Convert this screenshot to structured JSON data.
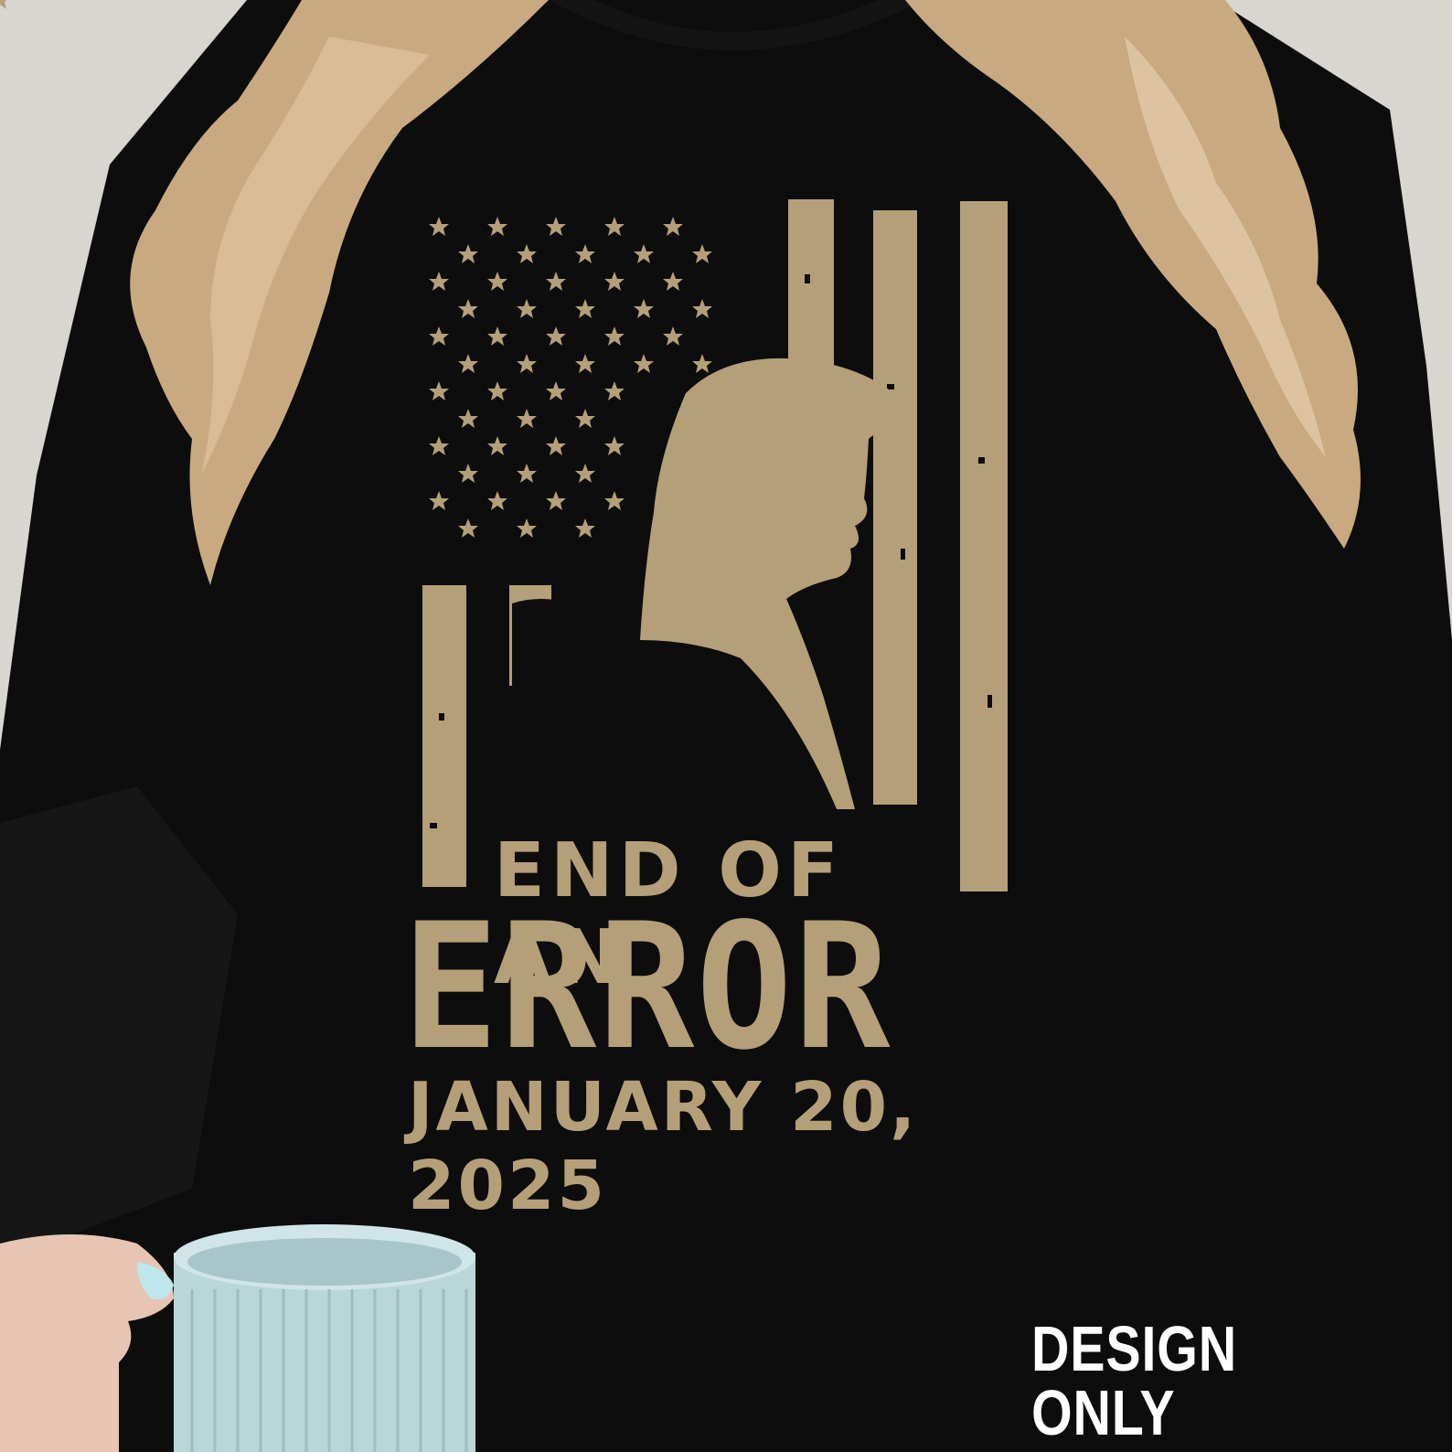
{
  "design": {
    "line1": "END OF AN",
    "line2": "ERROR",
    "line3": "JANUARY 20, 2025"
  },
  "overlay": {
    "label": "DESIGN ONLY"
  },
  "colors": {
    "print": "#b59f78",
    "garment": "#0d0d0d",
    "hair": "#c9a980",
    "mug": "#b9d6d8",
    "label": "#ffffff"
  }
}
